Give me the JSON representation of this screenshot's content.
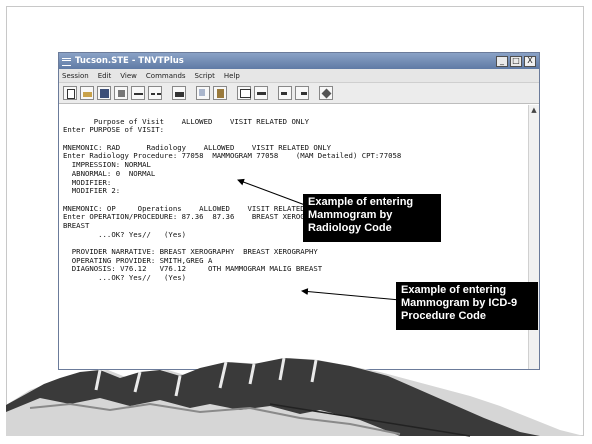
{
  "window": {
    "title": "Tucson.STE - TNVTPlus",
    "menu": [
      "Session",
      "Edit",
      "View",
      "Commands",
      "Script",
      "Help"
    ],
    "controls": {
      "minimize": "_",
      "maximize": "□",
      "close": "X"
    }
  },
  "toolbar": {
    "icons": [
      "new-icon",
      "open-icon",
      "save-icon",
      "properties-icon",
      "connect-icon",
      "disconnect-icon",
      "print-icon",
      "copy-icon",
      "paste-icon",
      "screen-icon",
      "capture-icon",
      "send-icon",
      "receive-icon",
      "macro-icon"
    ]
  },
  "terminal": {
    "lines": [
      "",
      "       Purpose of Visit    ALLOWED    VISIT RELATED ONLY",
      "Enter PURPOSE of VISIT:",
      "",
      "MNEMONIC: RAD      Radiology    ALLOWED    VISIT RELATED ONLY",
      "Enter Radiology Procedure: 77058  MAMMOGRAM 77058    (MAM Detailed) CPT:77058",
      "  IMPRESSION: NORMAL",
      "  ABNORMAL: 0  NORMAL",
      "  MODIFIER:",
      "  MODIFIER 2:",
      "",
      "MNEMONIC: OP     Operations    ALLOWED    VISIT RELATED ONLY",
      "Enter OPERATION/PROCEDURE: 87.36  87.36    BREAST XEROGRAPHY     XEROGRAPHY OF",
      "BREAST",
      "        ...OK? Yes//   (Yes)",
      "",
      "  PROVIDER NARRATIVE: BREAST XEROGRAPHY  BREAST XEROGRAPHY",
      "  OPERATING PROVIDER: SMITH,GREG A",
      "  DIAGNOSIS: V76.12   V76.12     OTH MAMMOGRAM MALIG BREAST",
      "        ...OK? Yes//   (Yes)"
    ]
  },
  "callouts": {
    "radiology": [
      "Example of entering",
      "Mammogram by",
      "Radiology Code"
    ],
    "icd9": [
      "Example of entering",
      "Mammogram by ICD-9",
      "Procedure Code"
    ]
  },
  "colors": {
    "titlebar": "#6f88b3",
    "callout_bg": "#000000",
    "mountain_dark": "#3a3a3a",
    "mountain_light": "#d6d6d6"
  }
}
